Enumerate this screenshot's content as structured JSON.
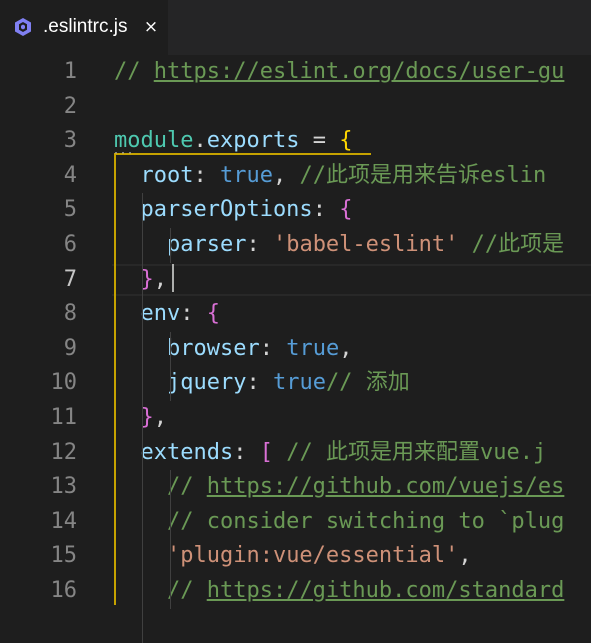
{
  "tab": {
    "label": ".eslintrc.js",
    "close_label": "×",
    "icon": "eslint-icon",
    "icon_color": "#8080f2"
  },
  "lines": [
    {
      "number": "1",
      "segments": [
        {
          "t": "// ",
          "c": "comment"
        },
        {
          "t": "https://eslint.org/docs/user-gu",
          "c": "link"
        }
      ]
    },
    {
      "number": "2",
      "segments": []
    },
    {
      "number": "3",
      "segments": [
        {
          "t": "module",
          "c": "var"
        },
        {
          "t": ".",
          "c": "plain"
        },
        {
          "t": "exports",
          "c": "prop"
        },
        {
          "t": " = ",
          "c": "plain"
        },
        {
          "t": "{",
          "c": "brace1"
        }
      ]
    },
    {
      "number": "4",
      "segments": [
        {
          "t": "  root",
          "c": "prop"
        },
        {
          "t": ": ",
          "c": "plain"
        },
        {
          "t": "true",
          "c": "kw"
        },
        {
          "t": ", ",
          "c": "plain"
        },
        {
          "t": "//此项是用来告诉eslin",
          "c": "comment"
        }
      ]
    },
    {
      "number": "5",
      "segments": [
        {
          "t": "  parserOptions",
          "c": "prop"
        },
        {
          "t": ": ",
          "c": "plain"
        },
        {
          "t": "{",
          "c": "brace2"
        }
      ]
    },
    {
      "number": "6",
      "segments": [
        {
          "t": "    parser",
          "c": "prop"
        },
        {
          "t": ": ",
          "c": "plain"
        },
        {
          "t": "'babel-eslint'",
          "c": "str"
        },
        {
          "t": " ",
          "c": "plain"
        },
        {
          "t": "//此项是",
          "c": "comment"
        }
      ]
    },
    {
      "number": "7",
      "segments": [
        {
          "t": "  ",
          "c": "plain"
        },
        {
          "t": "}",
          "c": "brace2"
        },
        {
          "t": ",",
          "c": "plain"
        }
      ]
    },
    {
      "number": "8",
      "segments": [
        {
          "t": "  env",
          "c": "prop"
        },
        {
          "t": ": ",
          "c": "plain"
        },
        {
          "t": "{",
          "c": "brace2"
        }
      ]
    },
    {
      "number": "9",
      "segments": [
        {
          "t": "    browser",
          "c": "prop"
        },
        {
          "t": ": ",
          "c": "plain"
        },
        {
          "t": "true",
          "c": "kw"
        },
        {
          "t": ",",
          "c": "plain"
        }
      ]
    },
    {
      "number": "10",
      "segments": [
        {
          "t": "    jquery",
          "c": "prop"
        },
        {
          "t": ": ",
          "c": "plain"
        },
        {
          "t": "true",
          "c": "kw"
        },
        {
          "t": "// 添加",
          "c": "comment"
        }
      ]
    },
    {
      "number": "11",
      "segments": [
        {
          "t": "  ",
          "c": "plain"
        },
        {
          "t": "}",
          "c": "brace2"
        },
        {
          "t": ",",
          "c": "plain"
        }
      ]
    },
    {
      "number": "12",
      "segments": [
        {
          "t": "  extends",
          "c": "prop"
        },
        {
          "t": ": ",
          "c": "plain"
        },
        {
          "t": "[",
          "c": "brace2"
        },
        {
          "t": " // 此项是用来配置vue.j",
          "c": "comment"
        }
      ]
    },
    {
      "number": "13",
      "segments": [
        {
          "t": "    // ",
          "c": "comment"
        },
        {
          "t": "https://github.com/vuejs/es",
          "c": "link"
        }
      ]
    },
    {
      "number": "14",
      "segments": [
        {
          "t": "    // consider switching to `plug",
          "c": "comment"
        }
      ]
    },
    {
      "number": "15",
      "segments": [
        {
          "t": "    ",
          "c": "plain"
        },
        {
          "t": "'plugin:vue/essential'",
          "c": "str"
        },
        {
          "t": ",",
          "c": "plain"
        }
      ]
    },
    {
      "number": "16",
      "segments": [
        {
          "t": "    // ",
          "c": "comment"
        },
        {
          "t": "https://github.com/standard",
          "c": "link"
        }
      ]
    }
  ],
  "current_line": "7"
}
